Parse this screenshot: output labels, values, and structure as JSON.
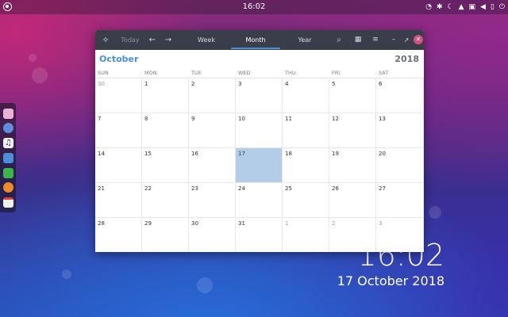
{
  "top_panel": {
    "clock": "16:02"
  },
  "dock": {
    "items": [
      {
        "name": "files-app",
        "color": "#e7b3d9"
      },
      {
        "name": "web-browser",
        "color": "#5e8de0"
      },
      {
        "name": "music-player",
        "color": "#eeeeee"
      },
      {
        "name": "file-manager",
        "color": "#4a90d9"
      },
      {
        "name": "spreadsheet",
        "color": "#3cb64b"
      },
      {
        "name": "firefox",
        "color": "#f08a24"
      },
      {
        "name": "calendar-app",
        "color": "#f0f0f0"
      }
    ]
  },
  "desktop_clock": {
    "time": "16:02",
    "date": "17 October 2018"
  },
  "calendar": {
    "header": {
      "today_label": "Today",
      "tabs": [
        "Week",
        "Month",
        "Year"
      ],
      "active_tab": "Month"
    },
    "month": "October",
    "year": "2018",
    "weekdays": [
      "SUN",
      "MON",
      "TUE",
      "WED",
      "THU",
      "FRI",
      "SAT"
    ],
    "weeks": [
      [
        {
          "d": "30",
          "o": true
        },
        {
          "d": "1"
        },
        {
          "d": "2"
        },
        {
          "d": "3"
        },
        {
          "d": "4"
        },
        {
          "d": "5"
        },
        {
          "d": "6"
        }
      ],
      [
        {
          "d": "7"
        },
        {
          "d": "8"
        },
        {
          "d": "9"
        },
        {
          "d": "10"
        },
        {
          "d": "11"
        },
        {
          "d": "12"
        },
        {
          "d": "13"
        }
      ],
      [
        {
          "d": "14"
        },
        {
          "d": "15"
        },
        {
          "d": "16"
        },
        {
          "d": "17",
          "today": true
        },
        {
          "d": "18"
        },
        {
          "d": "19"
        },
        {
          "d": "20"
        }
      ],
      [
        {
          "d": "21"
        },
        {
          "d": "22"
        },
        {
          "d": "23"
        },
        {
          "d": "24"
        },
        {
          "d": "25"
        },
        {
          "d": "26"
        },
        {
          "d": "27"
        }
      ],
      [
        {
          "d": "28"
        },
        {
          "d": "29"
        },
        {
          "d": "30"
        },
        {
          "d": "31"
        },
        {
          "d": "1",
          "o": true
        },
        {
          "d": "2",
          "o": true
        },
        {
          "d": "3",
          "o": true
        }
      ]
    ],
    "colors": {
      "accent": "#4a90d9",
      "today_highlight": "#b3cde9",
      "close": "#d6507a"
    }
  }
}
